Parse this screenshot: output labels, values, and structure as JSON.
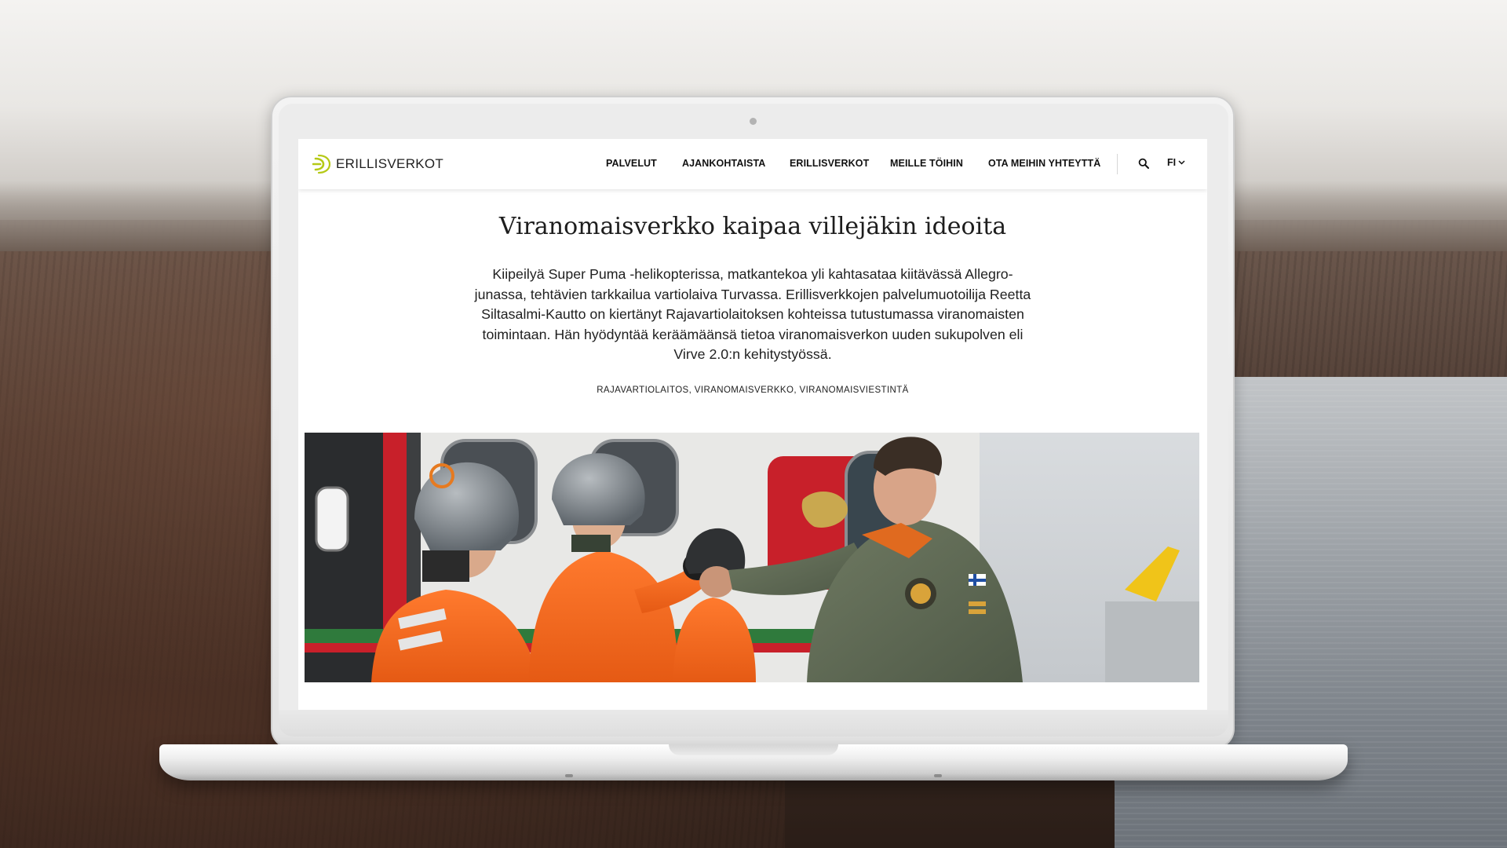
{
  "site": {
    "logo_text": "ERILLISVERKOT",
    "brand_color": "#b5c916"
  },
  "nav": {
    "items": [
      {
        "label": "PALVELUT"
      },
      {
        "label": "AJANKOHTAISTA"
      },
      {
        "label": "ERILLISVERKOT"
      },
      {
        "label": "MEILLE TÖIHIN"
      },
      {
        "label": "OTA MEIHIN YHTEYTTÄ"
      }
    ],
    "search_icon": "search-icon",
    "language": "FI"
  },
  "article": {
    "title": "Viranomaisverkko kaipaa villejäkin ideoita",
    "lead": "Kiipeilyä Super Puma -helikopterissa, matkantekoa yli kahtasataa kiitävässä Allegro-junassa, tehtävien tarkkailua vartiolaiva Turvassa. Erillisverkkojen palvelumuotoilija Reetta Siltasalmi-Kautto on kiertänyt Rajavartiolaitoksen kohteissa tutustumassa viranomaisten toimintaan. Hän hyödyntää keräämäänsä tietoa viranomaisverkon uuden sukupolven eli Virve 2.0:n kehitystyössä.",
    "tags": "RAJAVARTIOLAITOS, VIRANOMAISVERKKO, VIRANOMAISVIESTINTÄ"
  }
}
